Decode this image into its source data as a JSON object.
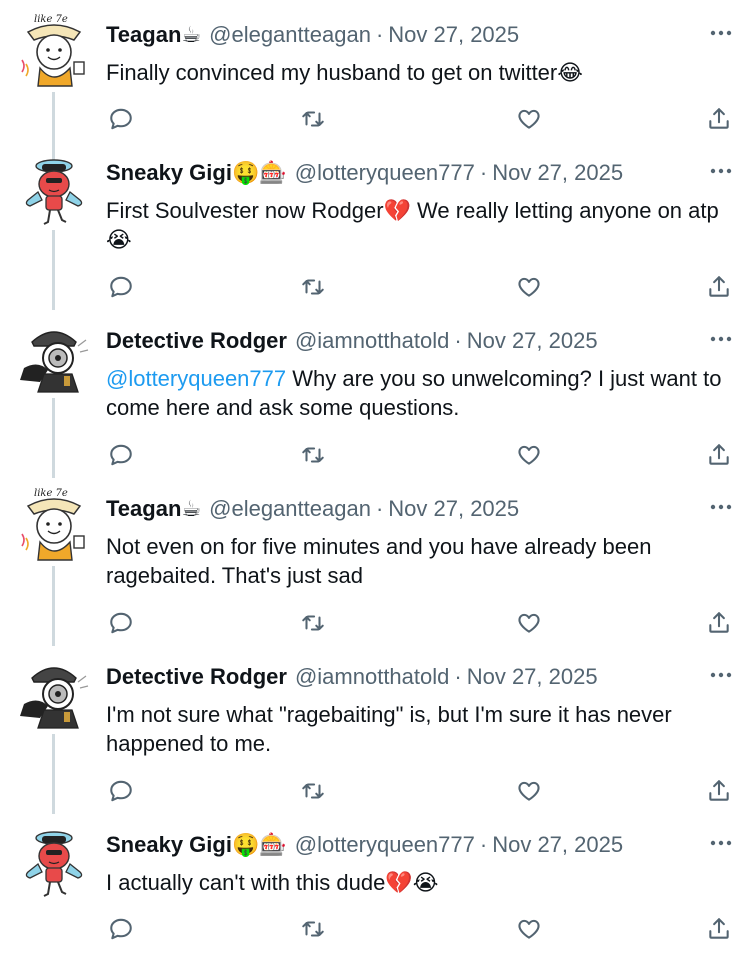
{
  "colors": {
    "text": "#0f1419",
    "secondary": "#536471",
    "mention": "#1d9bf0",
    "thread_line": "#cfd9de"
  },
  "tweets": [
    {
      "name": "Teagan",
      "name_emoji": "☕",
      "handle": "@elegantteagan",
      "separator": "·",
      "date": "Nov 27, 2025",
      "mention": "",
      "text": "Finally convinced my husband to get on twitter😂",
      "text_line2": "",
      "avatar_icon": "teagan-avatar-icon"
    },
    {
      "name": "Sneaky Gigi",
      "name_emoji": "🤑🎰",
      "handle": "@lotteryqueen777",
      "separator": "·",
      "date": "Nov 27, 2025",
      "mention": "",
      "text": "First Soulvester now Rodger💔 We really letting anyone on atp",
      "text_line2": "😭",
      "avatar_icon": "gigi-avatar-icon"
    },
    {
      "name": "Detective Rodger",
      "name_emoji": "",
      "handle": "@iamnotthatold",
      "separator": "·",
      "date": "Nov 27, 2025",
      "mention": "@lotteryqueen777",
      "text": " Why are you so unwelcoming? I just want to",
      "text_line2": "come here and ask some questions.",
      "avatar_icon": "rodger-avatar-icon"
    },
    {
      "name": "Teagan",
      "name_emoji": "☕",
      "handle": "@elegantteagan",
      "separator": "·",
      "date": "Nov 27, 2025",
      "mention": "",
      "text": "Not even on for five minutes and you have already been",
      "text_line2": "ragebaited. That's just sad",
      "avatar_icon": "teagan-avatar-icon"
    },
    {
      "name": "Detective Rodger",
      "name_emoji": "",
      "handle": "@iamnotthatold",
      "separator": "·",
      "date": "Nov 27, 2025",
      "mention": "",
      "text": "I'm not sure what \"ragebaiting\" is, but I'm sure it has never",
      "text_line2": "happened to me.",
      "avatar_icon": "rodger-avatar-icon"
    },
    {
      "name": "Sneaky Gigi",
      "name_emoji": "🤑🎰",
      "handle": "@lotteryqueen777",
      "separator": "·",
      "date": "Nov 27, 2025",
      "mention": "",
      "text": "I actually can't with this dude💔😭",
      "text_line2": "",
      "avatar_icon": "gigi-avatar-icon"
    }
  ],
  "action_icons": [
    "reply-icon",
    "retweet-icon",
    "like-icon",
    "share-icon"
  ],
  "more_icon": "more-icon"
}
